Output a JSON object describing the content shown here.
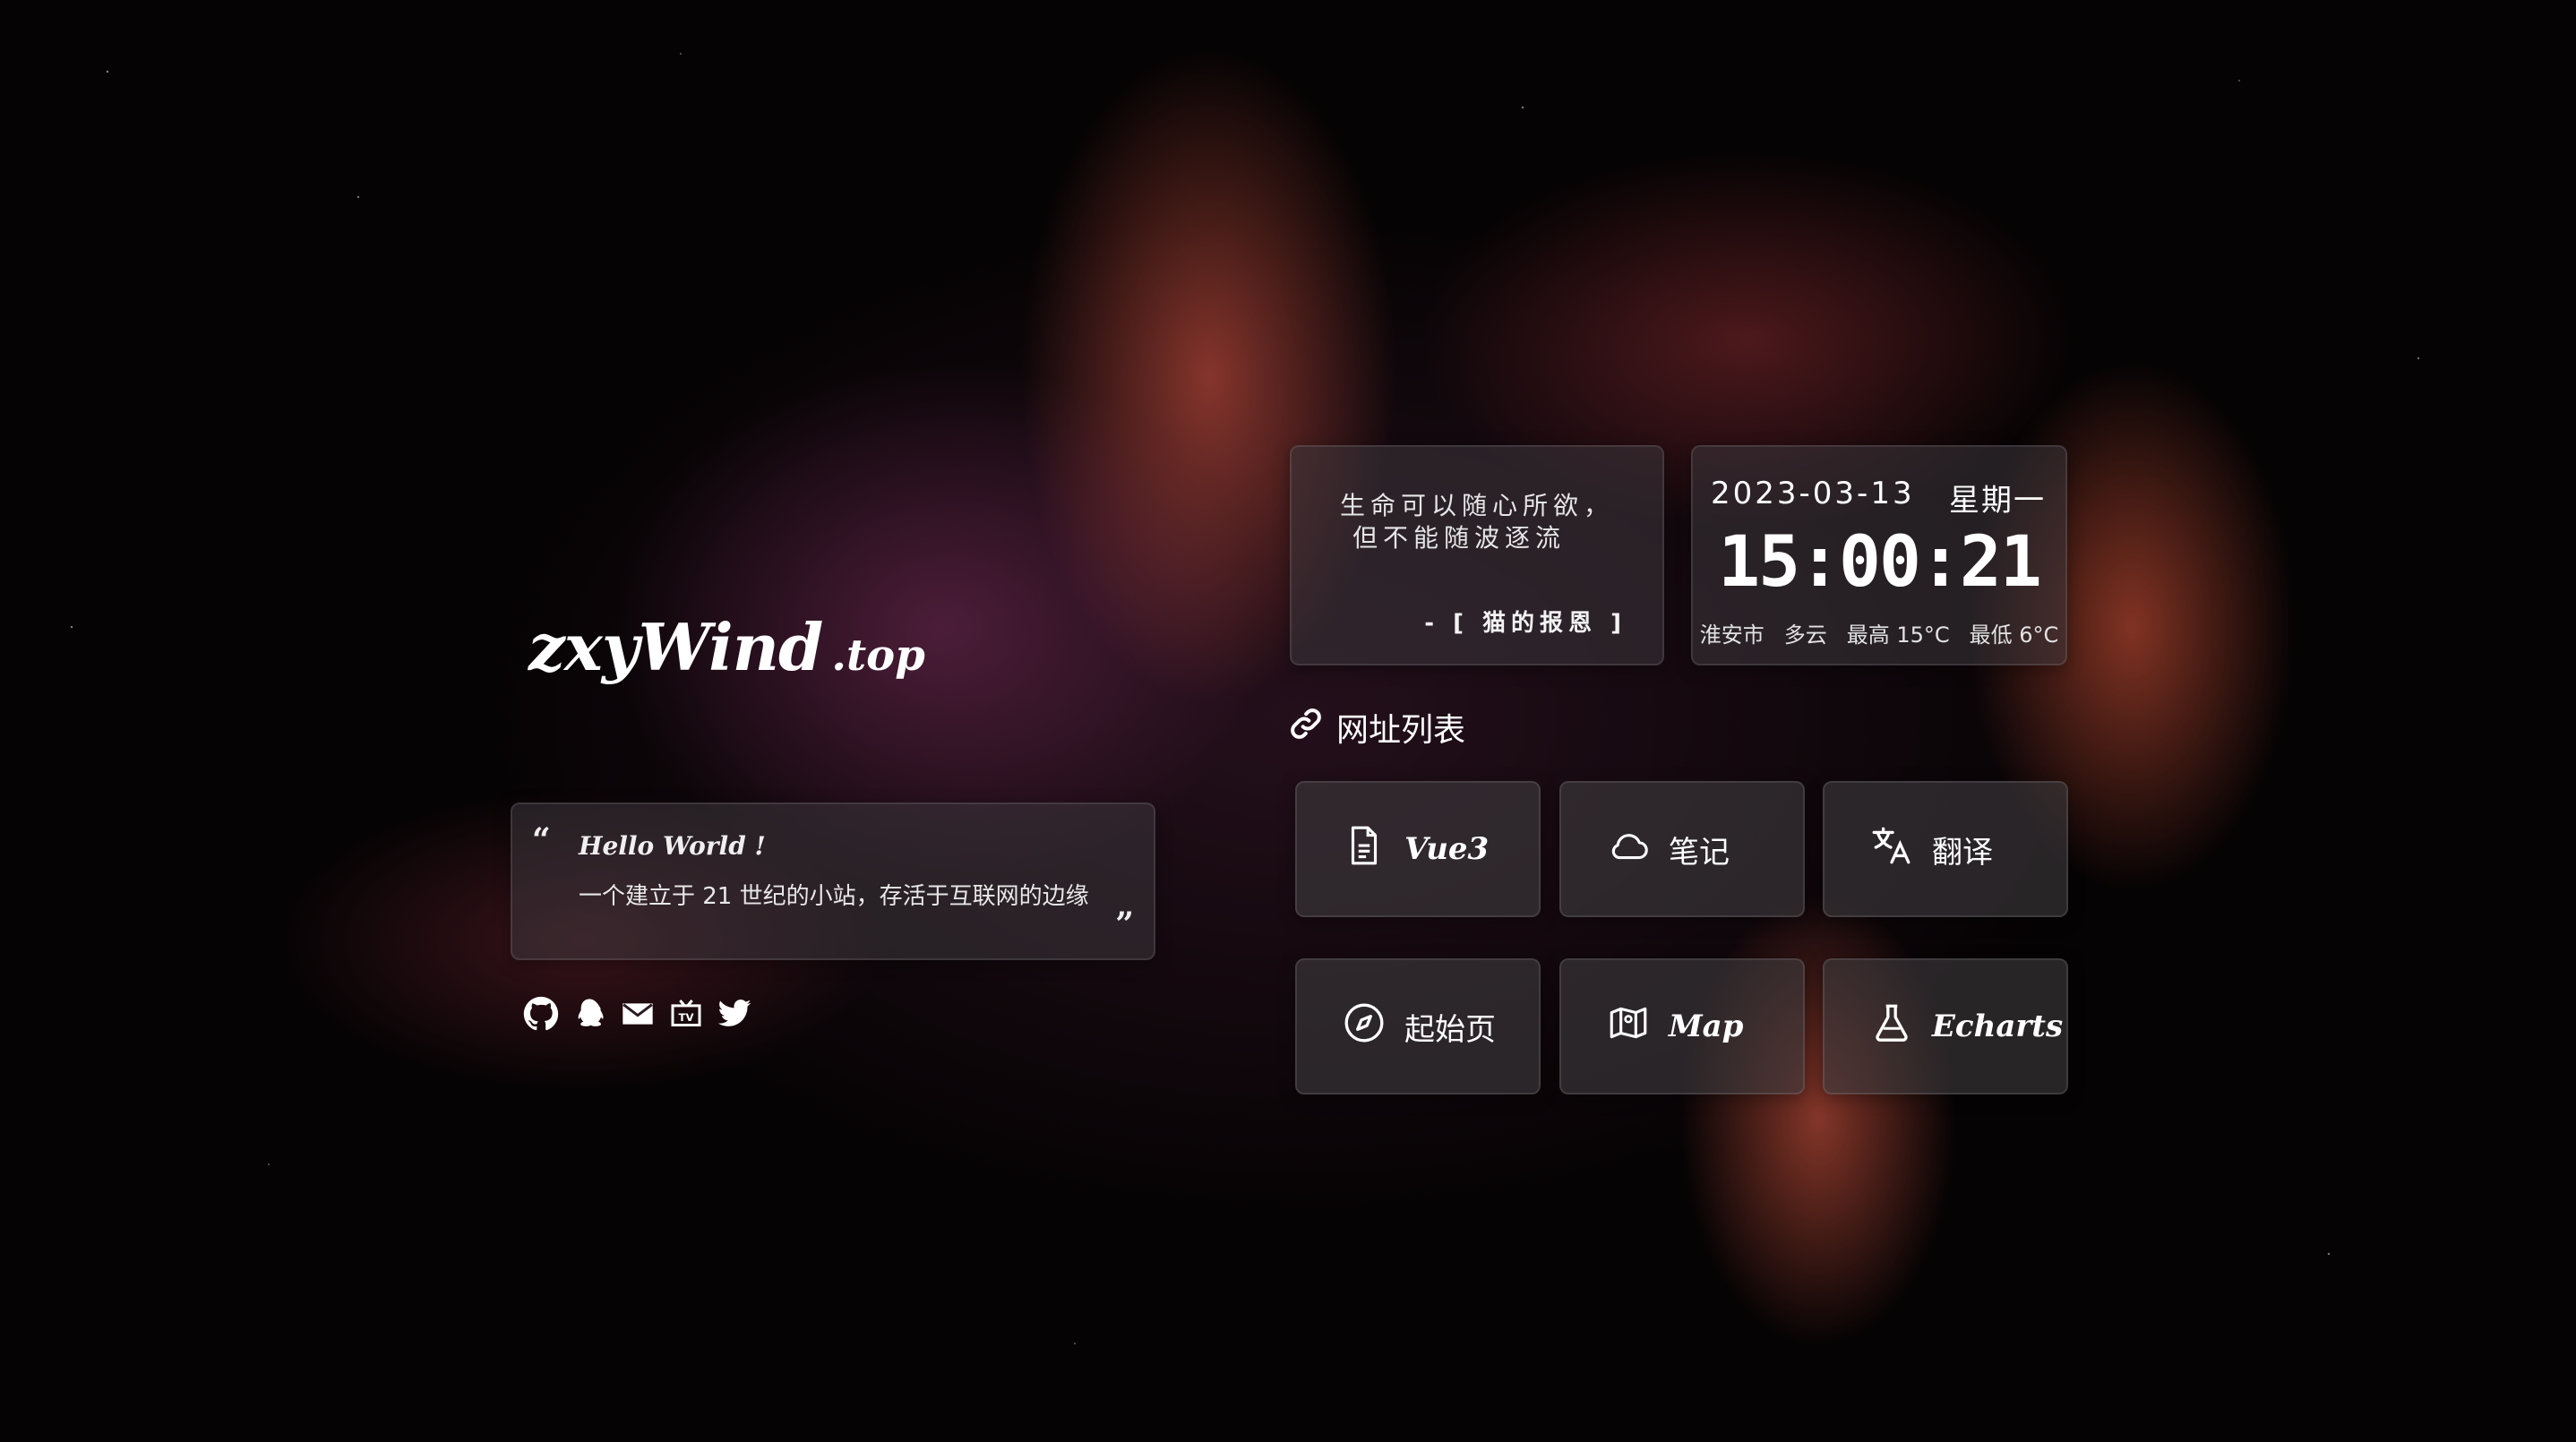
{
  "brand": {
    "main": "zxyWind",
    "sub": ".top"
  },
  "quote": {
    "open_mark": "“",
    "close_mark": "”",
    "hello": "Hello World !",
    "text": "一个建立于 21 世纪的小站，存活于互联网的边缘"
  },
  "social": [
    {
      "icon": "github-icon"
    },
    {
      "icon": "qq-icon"
    },
    {
      "icon": "mail-icon"
    },
    {
      "icon": "bilibili-tv-icon"
    },
    {
      "icon": "twitter-icon"
    }
  ],
  "motto": {
    "line1": "生命可以随心所欲，",
    "line2": "但不能随波逐流",
    "author": "- [ 猫的报恩 ]"
  },
  "clock": {
    "date": "2023-03-13",
    "weekday": "星期一",
    "time": "15:00:21",
    "city": "淮安市",
    "weather": "多云",
    "high": "最高 15°C",
    "low": "最低 6°C"
  },
  "links": {
    "title": "网址列表",
    "items": [
      {
        "label": "Vue3",
        "icon": "document-icon"
      },
      {
        "label": "笔记",
        "icon": "cloud-icon"
      },
      {
        "label": "翻译",
        "icon": "translate-icon"
      },
      {
        "label": "起始页",
        "icon": "compass-icon"
      },
      {
        "label": "Map",
        "icon": "map-icon"
      },
      {
        "label": "Echarts",
        "icon": "flask-icon"
      }
    ]
  }
}
